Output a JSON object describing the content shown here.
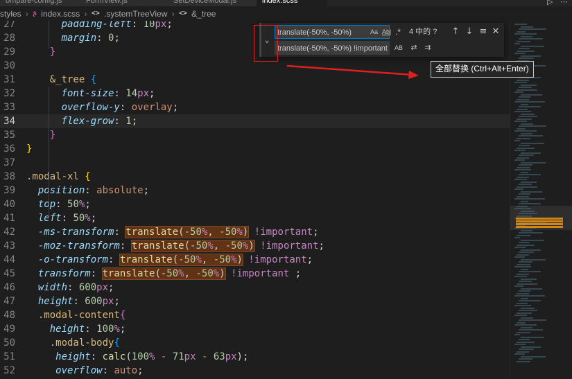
{
  "tabs": [
    {
      "label": "ompare-config.js",
      "active": false
    },
    {
      "label": "FormView.js",
      "active": false
    },
    {
      "label": "SetDeviceModal.js",
      "active": false
    },
    {
      "label": "index.scss",
      "active": true
    }
  ],
  "breadcrumb": {
    "folder": "styles",
    "file_icon": "scss-icon",
    "file": "index.scss",
    "symbol1": ".systemTreeView",
    "symbol2": "&_tree"
  },
  "find_widget": {
    "find_value": "translate(-50%, -50%)",
    "replace_value": "translate(-50%, -50%) !important",
    "match_case_label": "Aa",
    "whole_word_label": "Ab|",
    "regex_label": ".*",
    "preserve_case_label": "AB",
    "match_count": "4 中的 ?",
    "toggle_replace_icon": "chevron-down-icon",
    "prev_icon": "arrow-up-icon",
    "next_icon": "arrow-down-icon",
    "selection_icon": "find-in-selection-icon",
    "close_icon": "close-icon",
    "replace_one_icon": "replace-icon",
    "replace_all_icon": "replace-all-icon"
  },
  "tooltip": {
    "text": "全部替换 (Ctrl+Alt+Enter)"
  },
  "annotation": {
    "color": "#e02020"
  },
  "editor": {
    "current_line": 34,
    "lines": [
      {
        "n": "27",
        "text": "      padding-left: 10px;"
      },
      {
        "n": "28",
        "text": "      margin: 0;"
      },
      {
        "n": "29",
        "text": "    }"
      },
      {
        "n": "30",
        "text": ""
      },
      {
        "n": "31",
        "text": "    &_tree {"
      },
      {
        "n": "32",
        "text": "      font-size: 14px;"
      },
      {
        "n": "33",
        "text": "      overflow-y: overlay;"
      },
      {
        "n": "34",
        "text": "      flex-grow: 1;"
      },
      {
        "n": "35",
        "text": "    }"
      },
      {
        "n": "36",
        "text": "}"
      },
      {
        "n": "37",
        "text": ""
      },
      {
        "n": "38",
        "text": ".modal-xl {"
      },
      {
        "n": "39",
        "text": "  position: absolute;"
      },
      {
        "n": "40",
        "text": "  top: 50%;"
      },
      {
        "n": "41",
        "text": "  left: 50%;"
      },
      {
        "n": "42",
        "text": "  -ms-transform: translate(-50%, -50%) !important;"
      },
      {
        "n": "43",
        "text": "  -moz-transform: translate(-50%, -50%) !important;"
      },
      {
        "n": "44",
        "text": "  -o-transform: translate(-50%, -50%) !important;"
      },
      {
        "n": "45",
        "text": "  transform: translate(-50%, -50%) !important ;"
      },
      {
        "n": "46",
        "text": "  width: 600px;"
      },
      {
        "n": "47",
        "text": "  height: 600px;"
      },
      {
        "n": "48",
        "text": "  .modal-content{"
      },
      {
        "n": "49",
        "text": "    height: 100%;"
      },
      {
        "n": "50",
        "text": "    .modal-body{"
      },
      {
        "n": "51",
        "text": "     height: calc(100% - 71px - 63px);"
      },
      {
        "n": "52",
        "text": "     overflow: auto;"
      }
    ]
  }
}
